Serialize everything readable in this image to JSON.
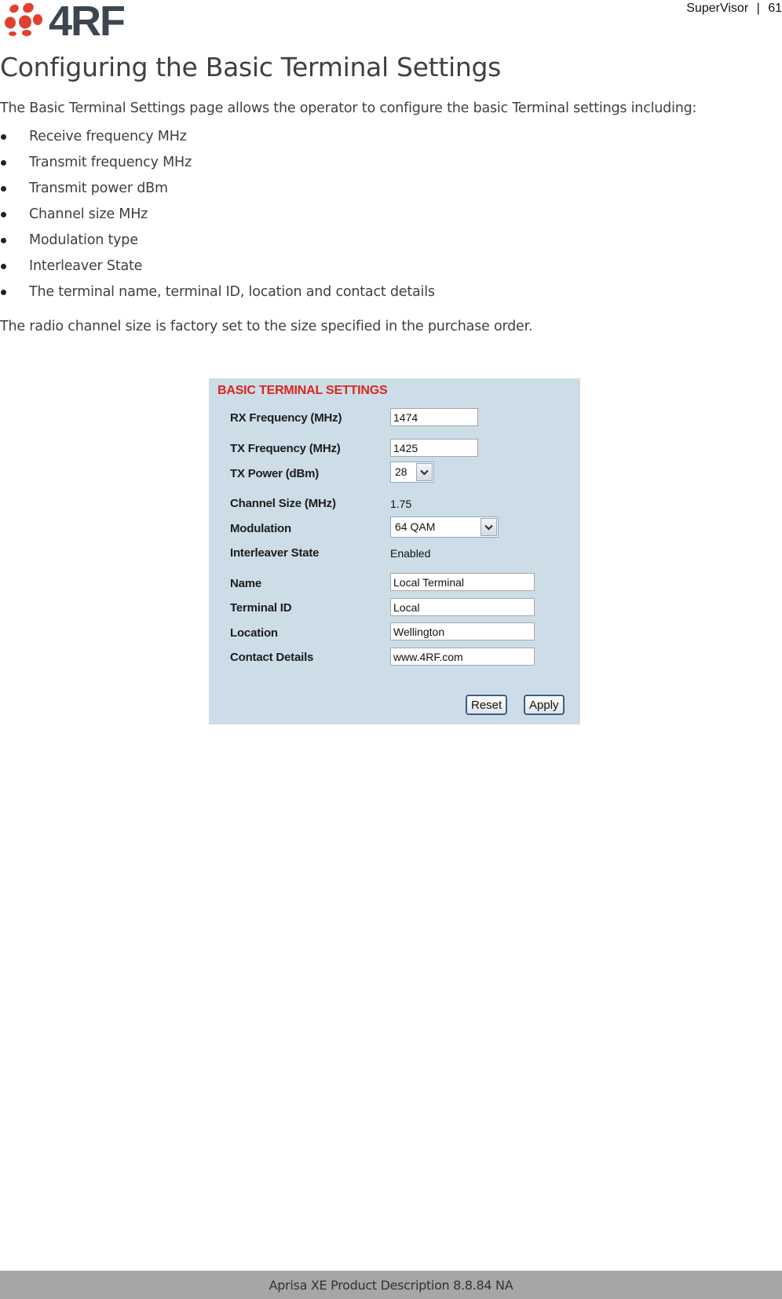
{
  "header": {
    "logo_text": "4RF",
    "section": "SuperVisor",
    "separator": "|",
    "page_number": "61",
    "brand_colors": {
      "dots": "#e0412f",
      "text": "#3b4650"
    }
  },
  "title": "Configuring the Basic Terminal Settings",
  "intro": "The Basic Terminal Settings page allows the operator to configure the basic Terminal settings including:",
  "bullets": [
    "Receive frequency MHz",
    "Transmit frequency MHz",
    "Transmit power dBm",
    "Channel size MHz",
    "Modulation type",
    "Interleaver State",
    "The terminal name, terminal ID, location and contact details"
  ],
  "note": "The radio channel size is factory set to the size specified in the purchase order.",
  "panel": {
    "title": "BASIC TERMINAL SETTINGS",
    "title_color": "#d9261c",
    "background": "#cddde8",
    "rx_frequency": {
      "label": "RX Frequency (MHz)",
      "value": "1474"
    },
    "tx_frequency": {
      "label": "TX Frequency (MHz)",
      "value": "1425"
    },
    "tx_power": {
      "label": "TX Power (dBm)",
      "value": "28"
    },
    "channel_size": {
      "label": "Channel Size (MHz)",
      "value": "1.75"
    },
    "modulation": {
      "label": "Modulation",
      "value": "64 QAM"
    },
    "interleaver": {
      "label": "Interleaver State",
      "value": "Enabled"
    },
    "name": {
      "label": "Name",
      "value": "Local Terminal"
    },
    "terminal_id": {
      "label": "Terminal ID",
      "value": "Local"
    },
    "location": {
      "label": "Location",
      "value": "Wellington"
    },
    "contact": {
      "label": "Contact Details",
      "value": "www.4RF.com"
    },
    "reset_label": "Reset",
    "apply_label": "Apply"
  },
  "footer": {
    "text": "Aprisa XE Product Description 8.8.84 NA"
  }
}
